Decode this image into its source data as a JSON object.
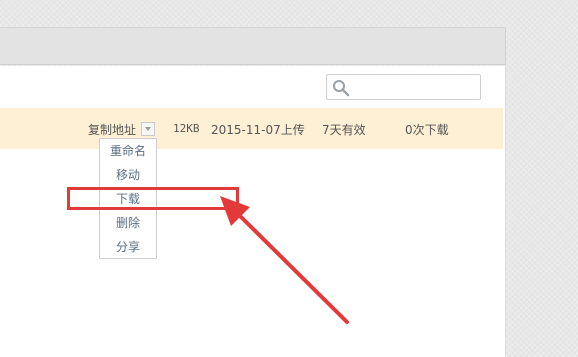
{
  "search": {
    "placeholder": "",
    "icon": "search-icon"
  },
  "file_row": {
    "action_label": "复制地址",
    "size": "12KB",
    "upload_date": "2015-11-07上传",
    "validity": "7天有效",
    "download_count": "0次下载"
  },
  "context_menu": {
    "items": [
      {
        "label": "重命名"
      },
      {
        "label": "移动"
      },
      {
        "label": "下载"
      },
      {
        "label": "删除"
      },
      {
        "label": "分享"
      }
    ],
    "highlighted": "下载"
  },
  "colors": {
    "row_bg": "#fdf0d5",
    "menu_text": "#5b6f86",
    "annotation_red": "#e23a3a"
  }
}
